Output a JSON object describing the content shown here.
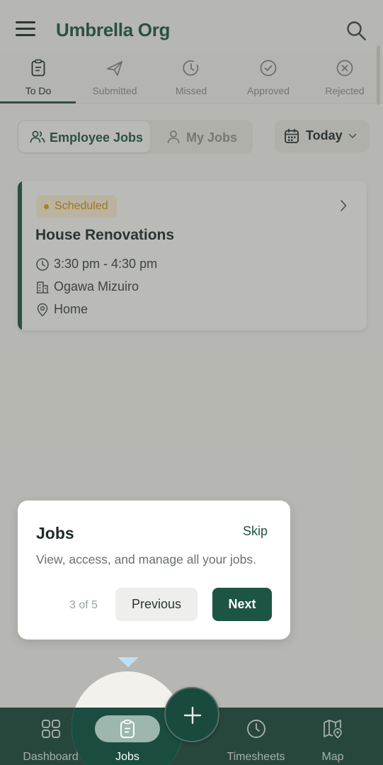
{
  "header": {
    "title": "Umbrella Org"
  },
  "status_tabs": [
    {
      "label": "To Do",
      "icon": "clipboard-icon",
      "active": true
    },
    {
      "label": "Submitted",
      "icon": "send-icon",
      "active": false
    },
    {
      "label": "Missed",
      "icon": "clock-alert-icon",
      "active": false
    },
    {
      "label": "Approved",
      "icon": "check-circle-icon",
      "active": false
    },
    {
      "label": "Rejected",
      "icon": "x-circle-icon",
      "active": false
    }
  ],
  "view_toggle": {
    "employee_jobs": "Employee Jobs",
    "my_jobs": "My Jobs",
    "selected": "Employee Jobs"
  },
  "date_filter": {
    "label": "Today"
  },
  "jobs": [
    {
      "status": "Scheduled",
      "title": "House Renovations",
      "time": "3:30 pm - 4:30 pm",
      "client": "Ogawa Mizuiro",
      "location": "Home"
    }
  ],
  "coachmark": {
    "title": "Jobs",
    "skip": "Skip",
    "description": "View, access, and manage all your jobs.",
    "counter": "3 of 5",
    "previous": "Previous",
    "next": "Next"
  },
  "bottom_nav": {
    "items": [
      {
        "label": "Dashboard",
        "icon": "grid-icon"
      },
      {
        "label": "Jobs",
        "icon": "clipboard-icon",
        "active": true
      },
      {
        "label": "Timesheets",
        "icon": "clock-icon"
      },
      {
        "label": "Map",
        "icon": "map-pin-icon"
      }
    ],
    "add_icon": "plus-icon"
  },
  "colors": {
    "brand": "#1d5545",
    "nav_background": "#16473b",
    "status_scheduled": "#d08e16",
    "background": "#f6f5f1"
  }
}
